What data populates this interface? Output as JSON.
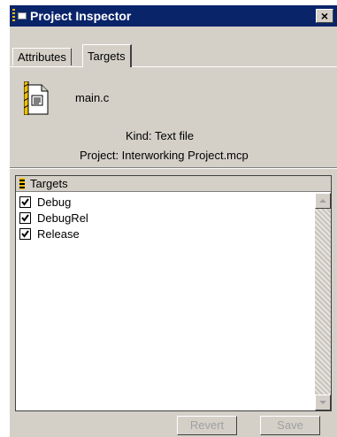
{
  "window": {
    "title": "Project Inspector",
    "close_label": "×"
  },
  "tabs": [
    {
      "label": "Attributes",
      "selected": false
    },
    {
      "label": "Targets",
      "selected": true
    }
  ],
  "file": {
    "icon": "source-file-icon",
    "name": "main.c",
    "kind_line": "Kind: Text file",
    "project_line": "Project: Interworking Project.mcp"
  },
  "targets_panel": {
    "header": "Targets",
    "items": [
      {
        "label": "Debug",
        "checked": true
      },
      {
        "label": "DebugRel",
        "checked": true
      },
      {
        "label": "Release",
        "checked": true
      }
    ]
  },
  "buttons": {
    "revert_label": "Revert",
    "save_label": "Save"
  },
  "colors": {
    "titlebar": "#0a246a",
    "face": "#d4d0c8",
    "disabled_text": "#a0a0a0"
  }
}
